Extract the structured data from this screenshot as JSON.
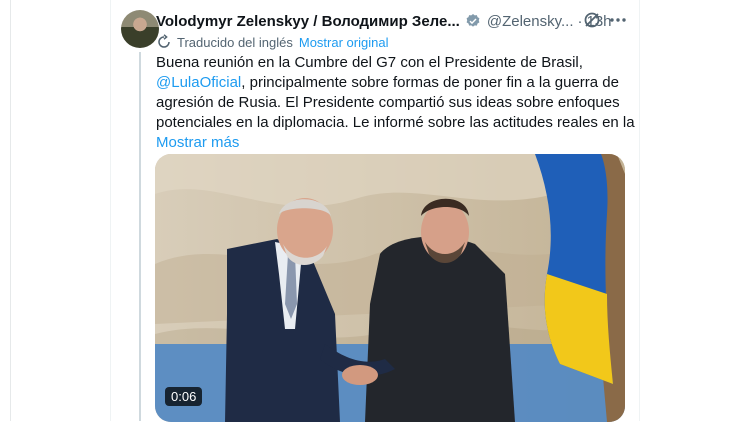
{
  "tweet": {
    "author_name": "Volodymyr Zelenskyy / Володимир Зеле...",
    "handle": "@Zelensky...",
    "separator": "·",
    "time": "13h",
    "translated_label": "Traducido del inglés",
    "show_original": "Mostrar original",
    "text_lines": [
      "Buena reunión en la Cumbre del G7 con el Presidente de Brasil,",
      ", principalmente sobre formas de poner fin a la guerra de",
      "agresión de Rusia. El Presidente compartió sus ideas sobre enfoques",
      "potenciales en la diplomacia. Le informé sobre las actitudes reales en la"
    ],
    "mention": "@LulaOficial",
    "show_more": "Mostrar más",
    "video_duration": "0:06"
  },
  "colors": {
    "accent": "#1d9bf0",
    "text": "#0f1419",
    "secondary_text": "#536471"
  },
  "icons": {
    "verified": "verified-badge-icon",
    "grok": "grok-icon",
    "more": "more-dots-icon",
    "translate": "translate-icon"
  }
}
